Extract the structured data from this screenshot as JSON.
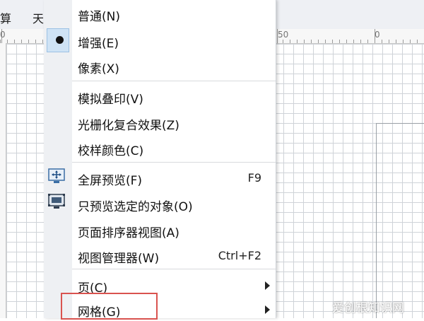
{
  "menubar": {
    "items": [
      {
        "label": "算"
      },
      {
        "label": "天"
      }
    ]
  },
  "ruler": {
    "labels": [
      "0",
      "50",
      "0"
    ]
  },
  "menu": {
    "items": [
      {
        "label": "普通(N)"
      },
      {
        "label": "增强(E)",
        "checked": true
      },
      {
        "label": "像素(X)"
      },
      {
        "label": "模拟叠印(V)"
      },
      {
        "label": "光栅化复合效果(Z)"
      },
      {
        "label": "校样颜色(C)"
      },
      {
        "label": "全屏预览(F)",
        "shortcut": "F9",
        "icon": "fullscreen-preview-icon"
      },
      {
        "label": "只预览选定的对象(O)",
        "icon": "preview-selected-icon"
      },
      {
        "label": "页面排序器视图(A)"
      },
      {
        "label": "视图管理器(W)",
        "shortcut": "Ctrl+F2"
      },
      {
        "label": "页(C)",
        "submenu": true
      },
      {
        "label": "网格(G)",
        "submenu": true
      }
    ]
  },
  "colors": {
    "highlight_border": "#d9534f",
    "check_bg": "#cfe3f5"
  },
  "watermark": {
    "text": "爱创根知识网"
  }
}
